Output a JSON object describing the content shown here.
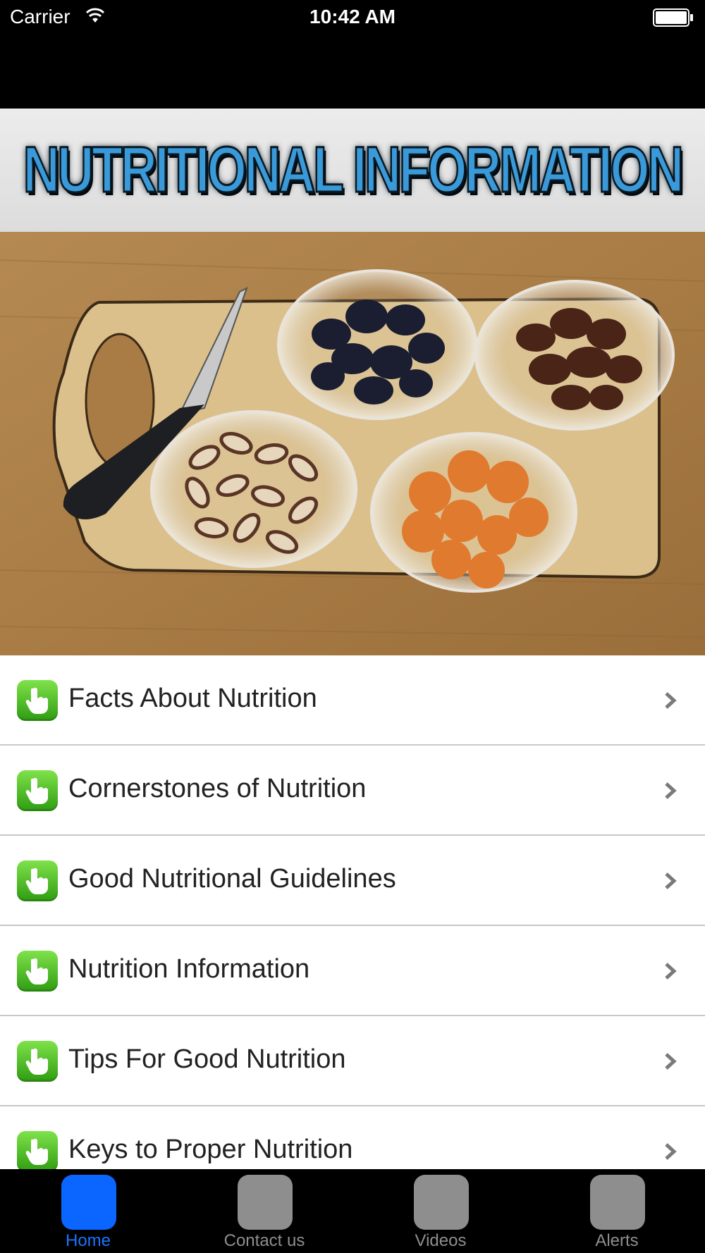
{
  "status_bar": {
    "carrier": "Carrier",
    "time": "10:42 AM"
  },
  "banner": {
    "title": "NUTRITIONAL INFORMATION"
  },
  "menu": {
    "items": [
      {
        "label": "Facts About Nutrition"
      },
      {
        "label": "Cornerstones of Nutrition"
      },
      {
        "label": "Good Nutritional Guidelines"
      },
      {
        "label": "Nutrition Information"
      },
      {
        "label": "Tips For Good Nutrition"
      },
      {
        "label": "Keys to Proper Nutrition"
      }
    ]
  },
  "tabs": [
    {
      "label": "Home",
      "active": true
    },
    {
      "label": "Contact us",
      "active": false
    },
    {
      "label": "Videos",
      "active": false
    },
    {
      "label": "Alerts",
      "active": false
    }
  ],
  "colors": {
    "accent": "#1a74ff",
    "row_icon": "#4cbf22",
    "banner_text": "#3a9ad9"
  }
}
